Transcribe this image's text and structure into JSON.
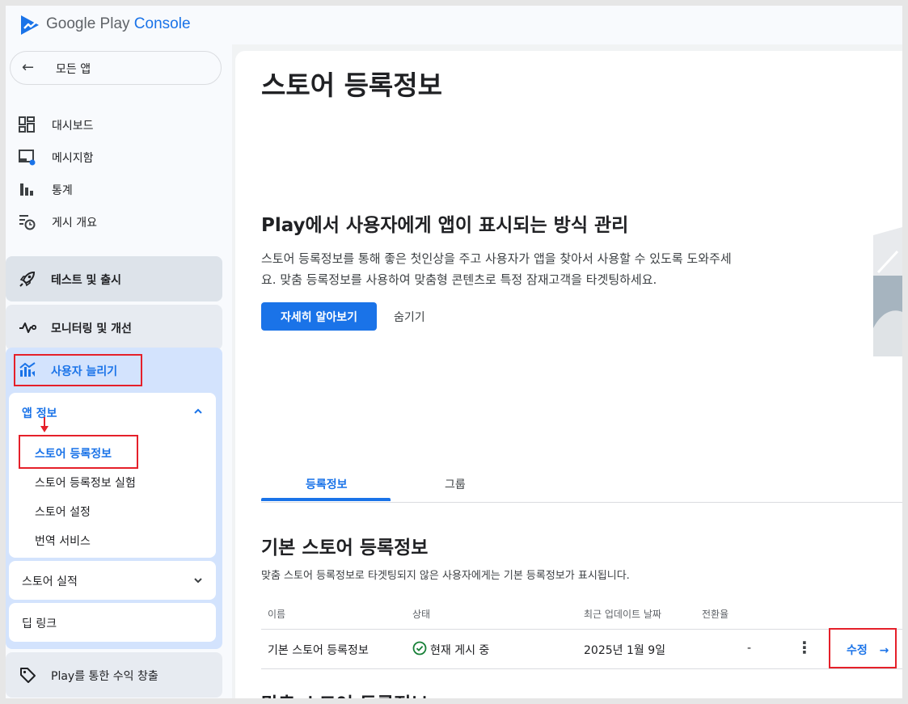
{
  "brand": {
    "part1": "Google Play",
    "part2": "Console"
  },
  "sidebar": {
    "all_apps": "모든 앱",
    "items": [
      {
        "label": "대시보드",
        "icon": "dashboard-icon"
      },
      {
        "label": "메시지함",
        "icon": "inbox-icon"
      },
      {
        "label": "통계",
        "icon": "bar-chart-icon"
      },
      {
        "label": "게시 개요",
        "icon": "publishing-overview-icon"
      }
    ],
    "sections": {
      "test_release": "테스트 및 출시",
      "monitor": "모니터링 및 개선",
      "grow": "사용자 늘리기",
      "monetize": "Play를 통한 수익 창출"
    },
    "app_info": {
      "label": "앱 정보",
      "items": [
        "스토어 등록정보",
        "스토어 등록정보 실험",
        "스토어 설정",
        "번역 서비스"
      ]
    },
    "store_performance": "스토어 실적",
    "deep_links": "딥 링크"
  },
  "main": {
    "title": "스토어 등록정보",
    "banner": {
      "title": "Play에서 사용자에게 앱이 표시되는 방식 관리",
      "desc_line1": "스토어 등록정보를 통해 좋은 첫인상을 주고 사용자가 앱을 찾아서 사용할 수 있도록 도와주세",
      "desc_line2": "요. 맞춤 등록정보를 사용하여 맞춤형 콘텐츠로 특정 잠재고객을 타겟팅하세요.",
      "learn_more": "자세히 알아보기",
      "hide": "숨기기"
    },
    "tabs": [
      "등록정보",
      "그룹"
    ],
    "default_listing": {
      "heading": "기본 스토어 등록정보",
      "subtitle": "맞춤 스토어 등록정보로 타겟팅되지 않은 사용자에게는 기본 등록정보가 표시됩니다.",
      "columns": [
        "이름",
        "상태",
        "최근 업데이트 날짜",
        "전환율"
      ],
      "row": {
        "name": "기본 스토어 등록정보",
        "status": "현재 게시 중",
        "updated": "2025년 1월 9일",
        "conversion": "-",
        "edit": "수정"
      }
    },
    "custom_heading": "맞춤 스토어 등록정보"
  },
  "colors": {
    "accent": "#1a73e8",
    "highlight_red": "#e5202a",
    "section_blue": "#d3e3fd"
  }
}
